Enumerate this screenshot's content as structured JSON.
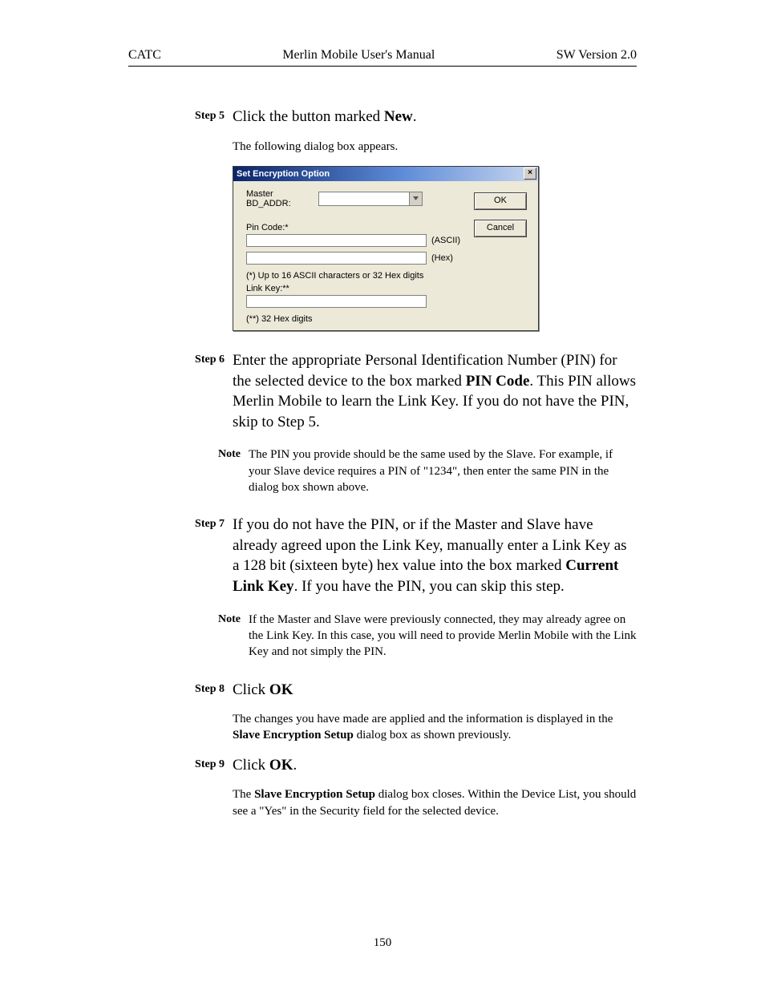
{
  "header": {
    "left": "CATC",
    "center": "Merlin Mobile User's Manual",
    "right": "SW Version 2.0"
  },
  "steps": {
    "step5": {
      "label": "Step 5",
      "body_pre": "Click the button marked ",
      "body_bold": "New",
      "body_post": ".",
      "followup": "The following dialog box appears."
    },
    "step6": {
      "label": "Step 6",
      "body_pre": "Enter the appropriate Personal Identification Number (PIN) for the selected device to the box marked ",
      "body_bold": "PIN Code",
      "body_post": ".  This PIN allows Merlin Mobile to learn the Link Key.  If you do not have the PIN, skip to Step 5."
    },
    "note6": {
      "label": "Note",
      "body": "The PIN you provide should be the same used by the Slave.  For example, if your Slave device requires a PIN of \"1234\", then enter the same PIN in the dialog box shown above."
    },
    "step7": {
      "label": "Step 7",
      "body_pre": "If you do not have the PIN, or if the Master and Slave have already agreed upon the Link Key, manually enter a Link Key as a 128 bit (sixteen byte) hex value into the box marked ",
      "body_bold": "Current Link Key",
      "body_post": ".  If you have the PIN, you can skip this step."
    },
    "note7": {
      "label": "Note",
      "body": "If the Master and Slave were previously connected, they may already agree on the Link Key.  In this case, you will need to provide Merlin Mobile with the Link Key and not simply the PIN."
    },
    "step8": {
      "label": "Step 8",
      "body_pre": "Click ",
      "body_bold": "OK",
      "body_post": "",
      "followup_pre": "The changes you have made are applied and the information is displayed in the ",
      "followup_bold": "Slave Encryption Setup",
      "followup_post": " dialog box as shown previously."
    },
    "step9": {
      "label": "Step 9",
      "body_pre": "Click ",
      "body_bold": "OK",
      "body_post": ".",
      "followup_pre": "The ",
      "followup_bold": "Slave Encryption Setup",
      "followup_post": " dialog box closes.  Within the Device List, you should see a \"Yes\" in the Security field for the selected device."
    }
  },
  "dialog": {
    "title": "Set Encryption Option",
    "master_label": "Master BD_ADDR:",
    "pin_label": "Pin Code:*",
    "ascii_suffix": "(ASCII)",
    "hex_suffix": "(Hex)",
    "pin_hint": "(*) Up to 16 ASCII characters or 32 Hex digits",
    "linkkey_label": "Link Key:**",
    "linkkey_hint": "(**) 32 Hex digits",
    "ok": "OK",
    "cancel": "Cancel",
    "close": "×"
  },
  "page_number": "150"
}
